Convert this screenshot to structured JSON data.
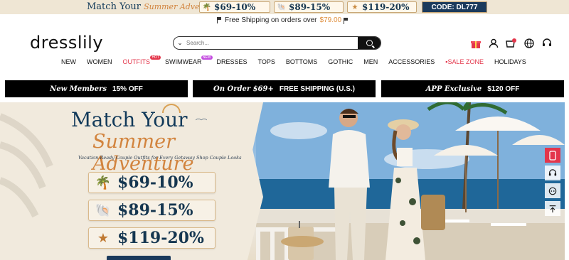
{
  "topbar": {
    "title_main": "Match Your",
    "title_script": "Summer Adventure",
    "tiers": [
      {
        "icon": "palm-tree-icon",
        "label": "$69-10%"
      },
      {
        "icon": "shell-icon",
        "label": "$89-15%"
      },
      {
        "icon": "starfish-icon",
        "label": "$119-20%"
      }
    ],
    "code": "CODE: DL777"
  },
  "shipping": {
    "text": "Free Shipping on orders over",
    "amount": "$79.00"
  },
  "header": {
    "logo": "dresslily",
    "search_placeholder": "Search..."
  },
  "nav": [
    {
      "label": "NEW"
    },
    {
      "label": "WOMEN"
    },
    {
      "label": "OUTFITS",
      "badge": "HOT",
      "color": "#e3364b"
    },
    {
      "label": "SWIMWEAR",
      "badge": "NEW"
    },
    {
      "label": "DRESSES"
    },
    {
      "label": "TOPS"
    },
    {
      "label": "BOTTOMS"
    },
    {
      "label": "GOTHIC"
    },
    {
      "label": "MEN"
    },
    {
      "label": "ACCESSORIES"
    },
    {
      "label": "SALE ZONE",
      "color": "#e3364b"
    },
    {
      "label": "HOLIDAYS"
    }
  ],
  "promos": [
    {
      "italic": "New Members",
      "bold": "15% OFF"
    },
    {
      "italic": "On Order $69+",
      "bold": "FREE SHIPPING (U.S.)"
    },
    {
      "italic": "APP Exclusive",
      "bold": "$120 OFF"
    }
  ],
  "hero": {
    "title_main": "Match Your",
    "title_script": "Summer Adventure",
    "subtitle": "Vacation-Ready Couple Outfits for Every Getaway Shop Couple Looks",
    "tiers": [
      {
        "icon": "palm-tree-icon",
        "label": "$69-10%"
      },
      {
        "icon": "shell-icon",
        "label": "$89-15%"
      },
      {
        "icon": "starfish-icon",
        "label": "$119-20%"
      }
    ]
  },
  "colors": {
    "accent": "#e3364b",
    "navy": "#153650",
    "gold": "#d2843e"
  }
}
